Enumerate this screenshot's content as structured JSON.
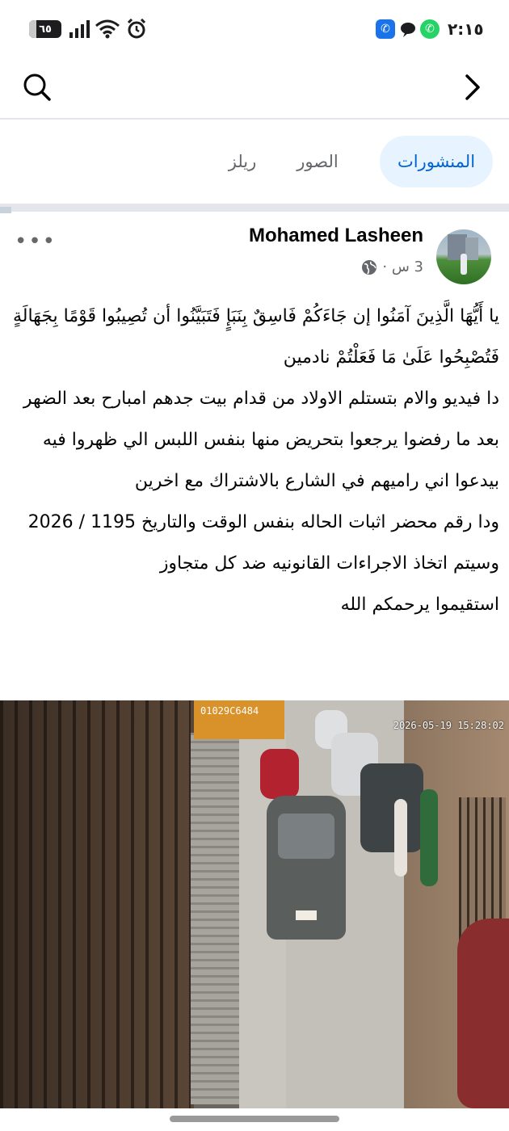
{
  "status_bar": {
    "time": "٢:١٥",
    "battery": "٦٥",
    "icons": [
      "alarm-icon",
      "wifi-icon",
      "signal-icon",
      "whatsapp-icon",
      "messages-icon",
      "phone-app-icon"
    ]
  },
  "top_nav": {
    "icons": [
      "search-icon",
      "chevron-right-icon"
    ]
  },
  "tabs": [
    {
      "label": "المنشورات",
      "active": true
    },
    {
      "label": "الصور",
      "active": false
    },
    {
      "label": "ريلز",
      "active": false
    }
  ],
  "post": {
    "author": "Mohamed Lasheen",
    "time": "3 س ·",
    "privacy_icon": "globe-icon",
    "lines": [
      "يا أَيُّهَا الَّذِينَ آمَنُوا إن جَاءَكُمْ فَاسِقٌ بِنَبَإٍ فَتَبَيَّنُوا أن تُصِيبُوا قَوْمًا بِجَهَالَةٍ فَتُصْبِحُوا عَلَىٰ مَا فَعَلْتُمْ نادمين",
      "دا فيديو والام بتستلم الاولاد من قدام بيت جدهم امبارح بعد الضهر بعد ما رفضوا يرجعوا بتحريض منها بنفس اللبس الي ظهروا فيه بيدعوا اني راميهم في الشارع بالاشتراك مع اخرين",
      "ودا رقم محضر اثبات الحاله بنفس الوقت والتاريخ 1195 / 2026",
      "وسيتم اتخاذ الاجراءات القانونيه ضد كل متجاوز",
      "استقيموا يرحمكم الله"
    ],
    "video": {
      "timestamp": "2026-05-19 15:28:02",
      "sign_text": "01029C6484"
    }
  },
  "colors": {
    "accent": "#0064d1",
    "active_tab_bg": "#e7f3ff",
    "secondary_text": "#65676b",
    "divider": "#e4e6eb"
  }
}
